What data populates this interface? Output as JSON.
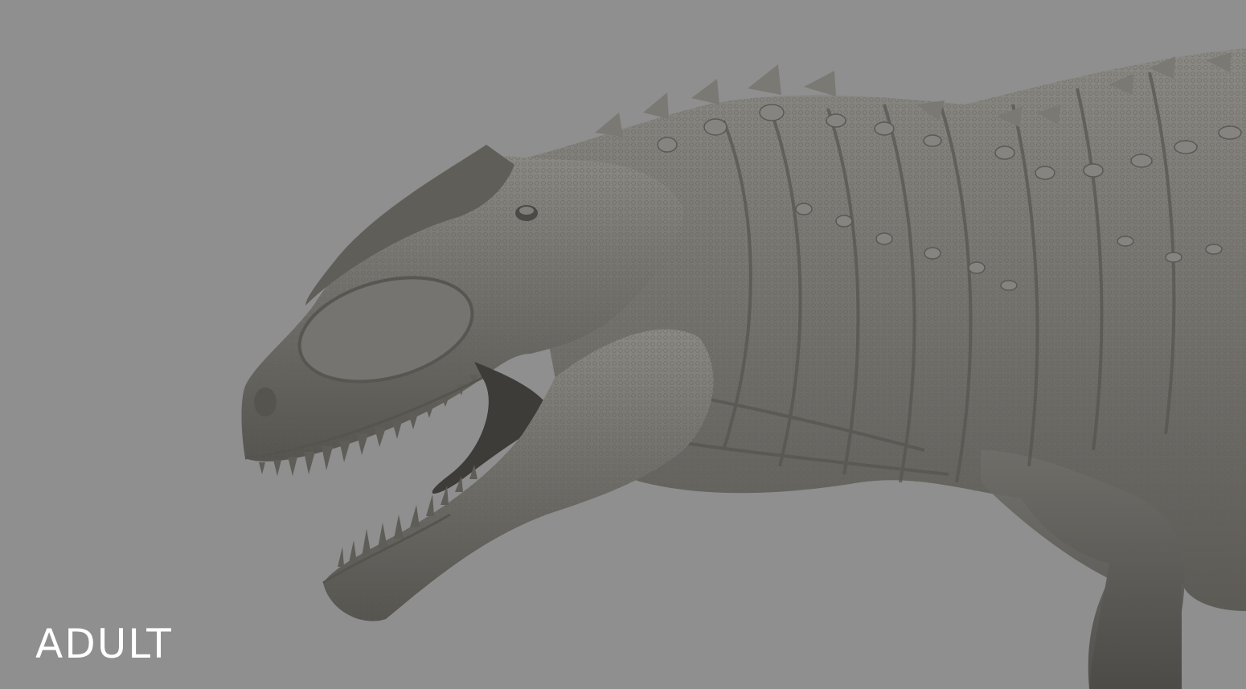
{
  "viewport": {
    "background_color": "#8f8f8f",
    "model_color": "#6f6e69",
    "model_highlight": "#8a8983",
    "model_shadow": "#4b4a46",
    "mouth_color": "#3d3c39"
  },
  "subject": {
    "icon": "dinosaur-sculpt"
  },
  "label": {
    "text": "ADULT",
    "color": "#ffffff"
  }
}
